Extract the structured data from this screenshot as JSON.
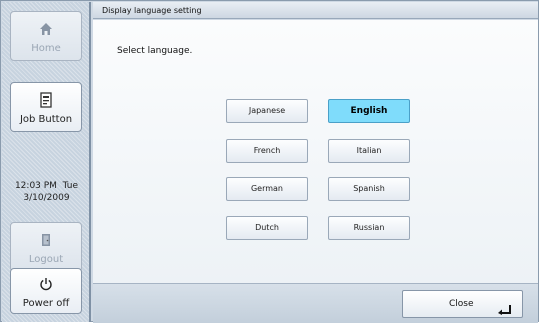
{
  "sidebar": {
    "home_label": "Home",
    "home_icon": "home-icon",
    "job_label": "Job Button",
    "job_icon": "job-document-icon",
    "time": "12:03 PM  Tue",
    "date": "3/10/2009",
    "logout_label": "Logout",
    "logout_icon": "logout-door-icon",
    "power_label": "Power off",
    "power_icon": "power-icon"
  },
  "window": {
    "title": "Display language setting",
    "prompt": "Select language."
  },
  "languages": [
    {
      "label": "Japanese",
      "selected": false
    },
    {
      "label": "English",
      "selected": true
    },
    {
      "label": "French",
      "selected": false
    },
    {
      "label": "Italian",
      "selected": false
    },
    {
      "label": "German",
      "selected": false
    },
    {
      "label": "Spanish",
      "selected": false
    },
    {
      "label": "Dutch",
      "selected": false
    },
    {
      "label": "Russian",
      "selected": false
    }
  ],
  "footer": {
    "close_label": "Close",
    "close_icon": "enter-return-icon"
  },
  "colors": {
    "selected_bg": "#7fdcfb",
    "sidebar_bg": "#c7d3df"
  }
}
